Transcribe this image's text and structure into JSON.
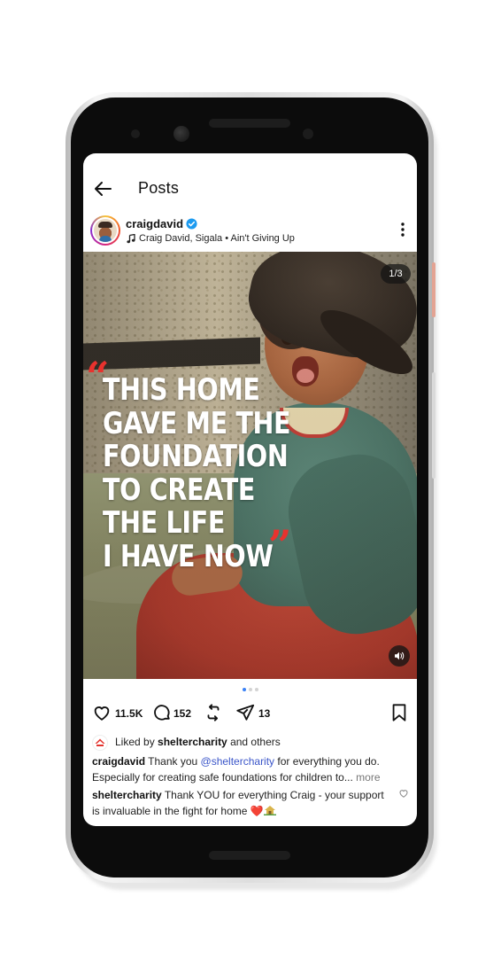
{
  "header": {
    "title": "Posts"
  },
  "post": {
    "username": "craigdavid",
    "audio": "Craig David, Sigala • Ain't Giving Up",
    "counter": "1/3",
    "quote_open": "“",
    "quote_close": "”",
    "quote_lines": [
      "THIS HOME",
      "GAVE ME THE",
      "FOUNDATION",
      "TO CREATE",
      "THE LIFE",
      "I HAVE NOW"
    ]
  },
  "actions": {
    "likes": "11.5K",
    "comments": "152",
    "shares": "13"
  },
  "liked_by": {
    "prefix": "Liked by ",
    "user": "sheltercharity",
    "suffix": " and others"
  },
  "caption": {
    "user": "craigdavid",
    "text_before": " Thank you ",
    "mention": "@sheltercharity",
    "text_after": " for everything you do. Especially for creating safe foundations for children to...",
    "more": " more"
  },
  "comment": {
    "user": "sheltercharity",
    "text": " Thank YOU for everything Craig - your support is invaluable in the fight for home ",
    "emoji": "❤️"
  },
  "colors": {
    "accent_blue": "#3b82f6",
    "quote_red": "#e8322e",
    "verified": "#1d9bf0",
    "mention": "#3a55c9"
  },
  "icons": [
    "back-arrow-icon",
    "verified-icon",
    "music-note-icon",
    "more-vertical-icon",
    "sound-icon",
    "heart-icon",
    "comment-icon",
    "repost-icon",
    "send-icon",
    "bookmark-icon",
    "shelter-logo-icon",
    "house-icon"
  ]
}
